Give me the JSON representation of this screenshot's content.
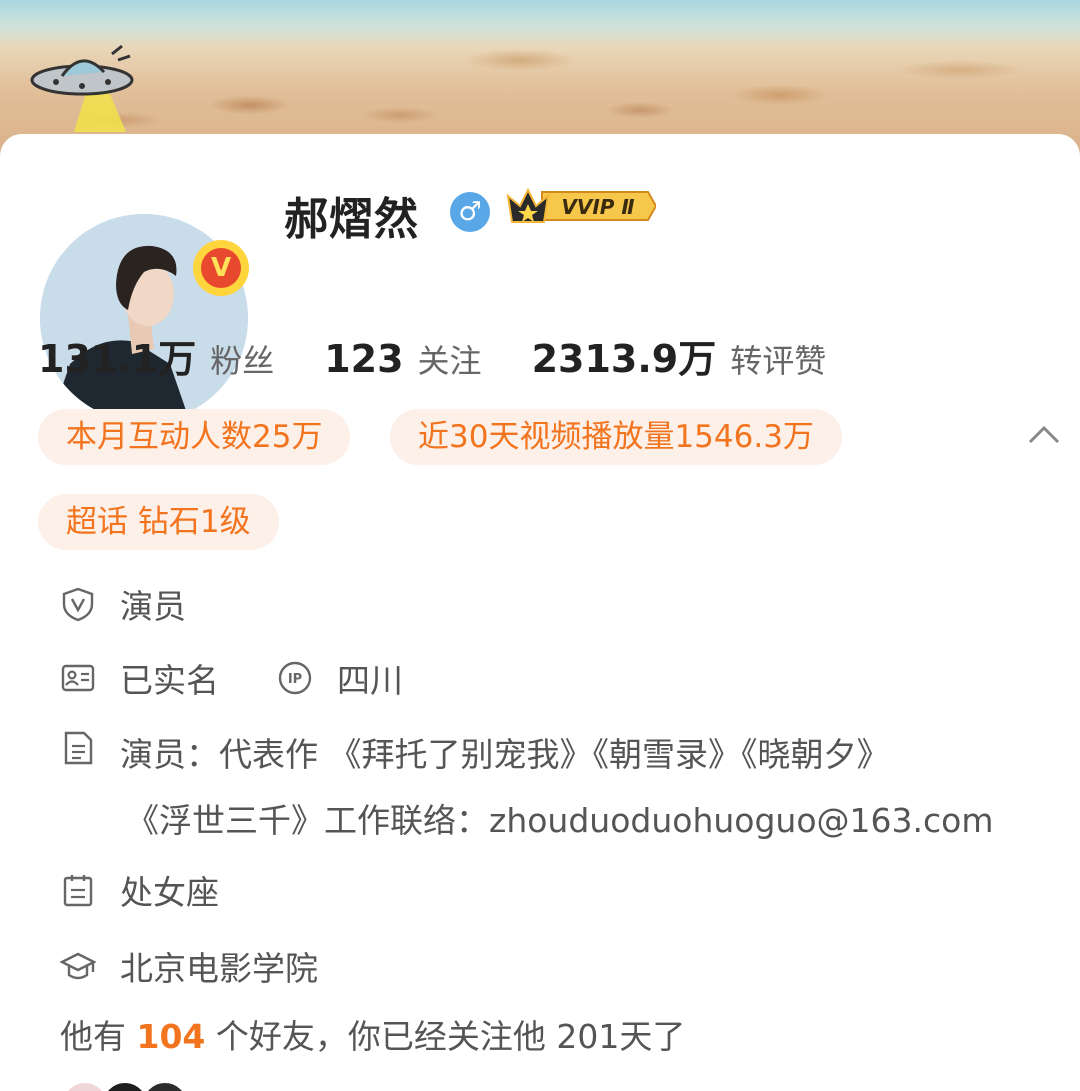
{
  "profile": {
    "name": "郝熠然",
    "gender_icon": "male-icon",
    "gender_symbol": "♂",
    "verified_badge": "V",
    "vip_label": "VVIP Ⅱ"
  },
  "stats": [
    {
      "value": "131.1万",
      "label": "粉丝"
    },
    {
      "value": "123",
      "label": "关注"
    },
    {
      "value": "2313.9万",
      "label": "转评赞"
    }
  ],
  "tags": {
    "monthly_interaction": "本月互动人数25万",
    "video_plays": "近30天视频播放量1546.3万",
    "supertopic": "超话 钻石1级"
  },
  "info": {
    "occupation": "演员",
    "real_name": "已实名",
    "ip_badge": "IP",
    "ip_location": "四川",
    "bio_line1": "演员：代表作 《拜托了别宠我》《朝雪录》《晓朝夕》",
    "bio_line2": "《浮世三千》工作联络：zhouduoduohuoguo@163.com",
    "zodiac": "处女座",
    "school": "北京电影学院"
  },
  "friends": {
    "prefix": "他有",
    "count": "104",
    "middle": "个好友，你已经关注他",
    "days": "201",
    "suffix": "天了"
  },
  "colors": {
    "accent_orange": "#f2741f",
    "tag_bg": "#fdf0e8",
    "text_primary": "#222222",
    "text_secondary": "#666666",
    "gender_blue": "#5aa7e8",
    "badge_yellow": "#ffd53d",
    "badge_red": "#e8482e"
  }
}
